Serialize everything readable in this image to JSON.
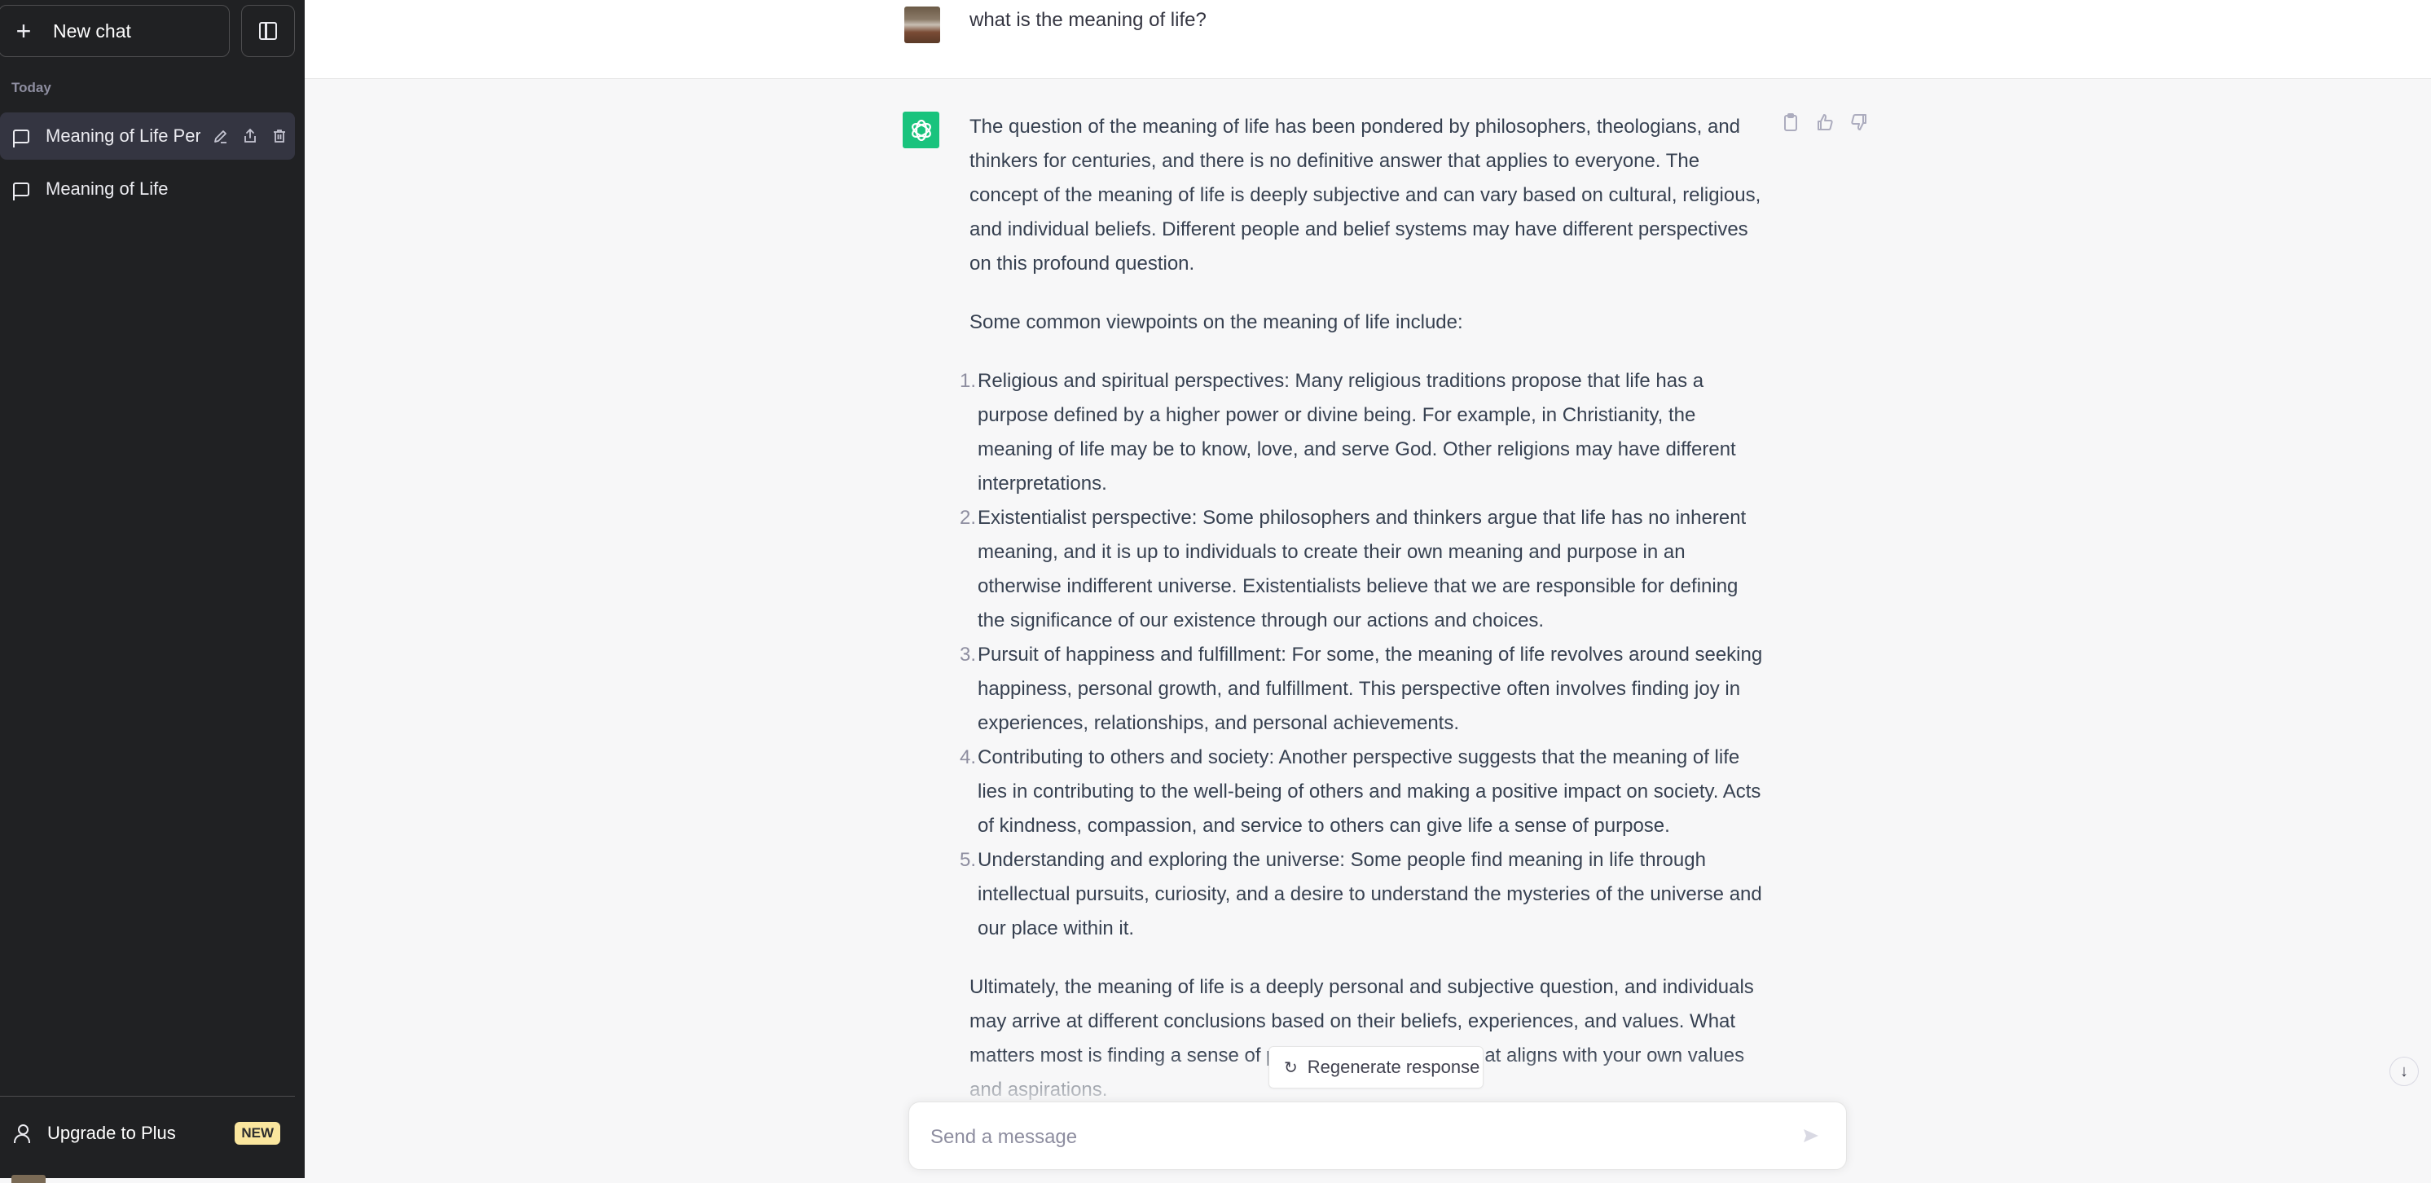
{
  "sidebar": {
    "new_chat_label": "New chat",
    "section_label": "Today",
    "chats": [
      {
        "title": "Meaning of Life Pers",
        "active": true
      },
      {
        "title": "Meaning of Life",
        "active": false
      }
    ],
    "upgrade_label": "Upgrade to Plus",
    "upgrade_badge": "NEW"
  },
  "conversation": {
    "user_message": "what is the meaning of life?",
    "assistant": {
      "intro": "The question of the meaning of life has been pondered by philosophers, theologians, and thinkers for centuries, and there is no definitive answer that applies to everyone. The concept of the meaning of life is deeply subjective and can vary based on cultural, religious, and individual beliefs. Different people and belief systems may have different perspectives on this profound question.",
      "list_intro": "Some common viewpoints on the meaning of life include:",
      "items": [
        {
          "num": "1.",
          "text": "Religious and spiritual perspectives: Many religious traditions propose that life has a purpose defined by a higher power or divine being. For example, in Christianity, the meaning of life may be to know, love, and serve God. Other religions may have different interpretations."
        },
        {
          "num": "2.",
          "text": "Existentialist perspective: Some philosophers and thinkers argue that life has no inherent meaning, and it is up to individuals to create their own meaning and purpose in an otherwise indifferent universe. Existentialists believe that we are responsible for defining the significance of our existence through our actions and choices."
        },
        {
          "num": "3.",
          "text": "Pursuit of happiness and fulfillment: For some, the meaning of life revolves around seeking happiness, personal growth, and fulfillment. This perspective often involves finding joy in experiences, relationships, and personal achievements."
        },
        {
          "num": "4.",
          "text": "Contributing to others and society: Another perspective suggests that the meaning of life lies in contributing to the well-being of others and making a positive impact on society. Acts of kindness, compassion, and service to others can give life a sense of purpose."
        },
        {
          "num": "5.",
          "text": "Understanding and exploring the universe: Some people find meaning in life through intellectual pursuits, curiosity, and a desire to understand the mysteries of the universe and our place within it."
        }
      ],
      "conclusion": "Ultimately, the meaning of life is a deeply personal and subjective question, and individuals may arrive at different conclusions based on their beliefs, experiences, and values. What matters most is finding a sense of purpose and fulfillment that aligns with your own values and aspirations."
    }
  },
  "composer": {
    "regenerate_label": "Regenerate response",
    "placeholder": "Send a message",
    "value": ""
  },
  "colors": {
    "sidebar_bg": "#202123",
    "brand_green": "#19c37d",
    "badge_bg": "#fae69e"
  }
}
